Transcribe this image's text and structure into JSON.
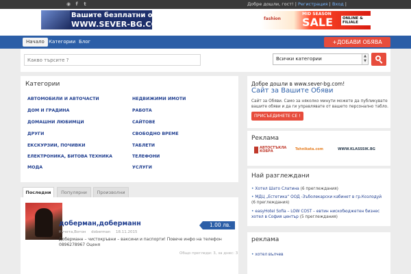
{
  "social": {
    "icons": [
      "rss-icon",
      "facebook-icon",
      "twitter-icon"
    ]
  },
  "userbar": {
    "greeting": "Добре дошли, гост!",
    "sep1": "|",
    "register": "Регистрация",
    "sep2": "|",
    "login": "Вход",
    "sep3": "|"
  },
  "logo": {
    "line1": "Вашите безплатни обяви",
    "line2": "WWW.SEVER-BG.COM"
  },
  "banner": {
    "brand": "fashion",
    "mid": "MID SEASON",
    "sale": "SALE",
    "online": "ONLINE & FILIALE"
  },
  "nav": {
    "home": "Начало",
    "categories": "Категории",
    "blog": "Блог",
    "add": "+ДОБАВИ ОБЯВА"
  },
  "search": {
    "placeholder": "Какво търсите ?",
    "category": "Всички категории"
  },
  "categories": {
    "title": "Категории",
    "left": [
      "АВТОМОБИЛИ И АВТОЧАСТИ",
      "ДОМ И ГРАДИНА",
      "ДОМАШНИ ЛЮБИМЦИ",
      "ДРУГИ",
      "ЕКСКУРЗИИ, ПОЧИВКИ",
      "ЕЛЕКТРОНИКА, БИТОВА ТЕХНИКА",
      "МОДА"
    ],
    "right": [
      "НЕДВИЖИМИ ИМОТИ",
      "РАБОТА",
      "САЙТОВЕ",
      "СВОБОДНО ВРЕМЕ",
      "ТАБЛЕТИ",
      "ТЕЛЕФОНИ",
      "УСЛУГИ"
    ]
  },
  "tabs": [
    "Последни",
    "Популярни",
    "Произволни"
  ],
  "ad": {
    "title": "доберман,доберманн",
    "price": "1.00 лв.",
    "location": "Кучета,Вотон",
    "author": "doberman",
    "date": "18.11.2015",
    "description": "Доберманн – чистокръвни – ваксини и паспорти! Повече инфо на телефон 0896278967 Оценя",
    "footer": "Общо прегледи: 3, за днес: 3"
  },
  "welcome": {
    "line1": "Добре дошли в www.sever-bg.com!",
    "line2": "Сайт за Вашите Обяви",
    "text": "Сайт за Обяви. Само за няколко минути можете да публикувате вашите обяви и да ги управлявате от вашето персонално табло.",
    "join": "ПРИСЪЕДИНЕТЕ СЕ !"
  },
  "ads_box": {
    "title": "Реклама",
    "logo1": "АВТОСТЪКЛА КОБРА",
    "logo2": "Tehnikata.com",
    "logo3": "WWW.KLASSSIK.BG"
  },
  "most_viewed": {
    "title": "Най разглеждани",
    "items": [
      {
        "text": "Хотел Шато Слатина",
        "count": "(6 преглеждания)"
      },
      {
        "text": "МДЦ „Естетика“ ООД -Зъболекарски кабинет в гр.Козлодуй",
        "count": "(6 преглеждания)"
      },
      {
        "text": "easyHotel Sofia – LOW COST – евтин нискобюджетен бизнес хотел в София център",
        "count": "(5 преглеждания)"
      }
    ]
  },
  "reklama2": {
    "title": "реклама",
    "item": "хотел вълчев"
  }
}
